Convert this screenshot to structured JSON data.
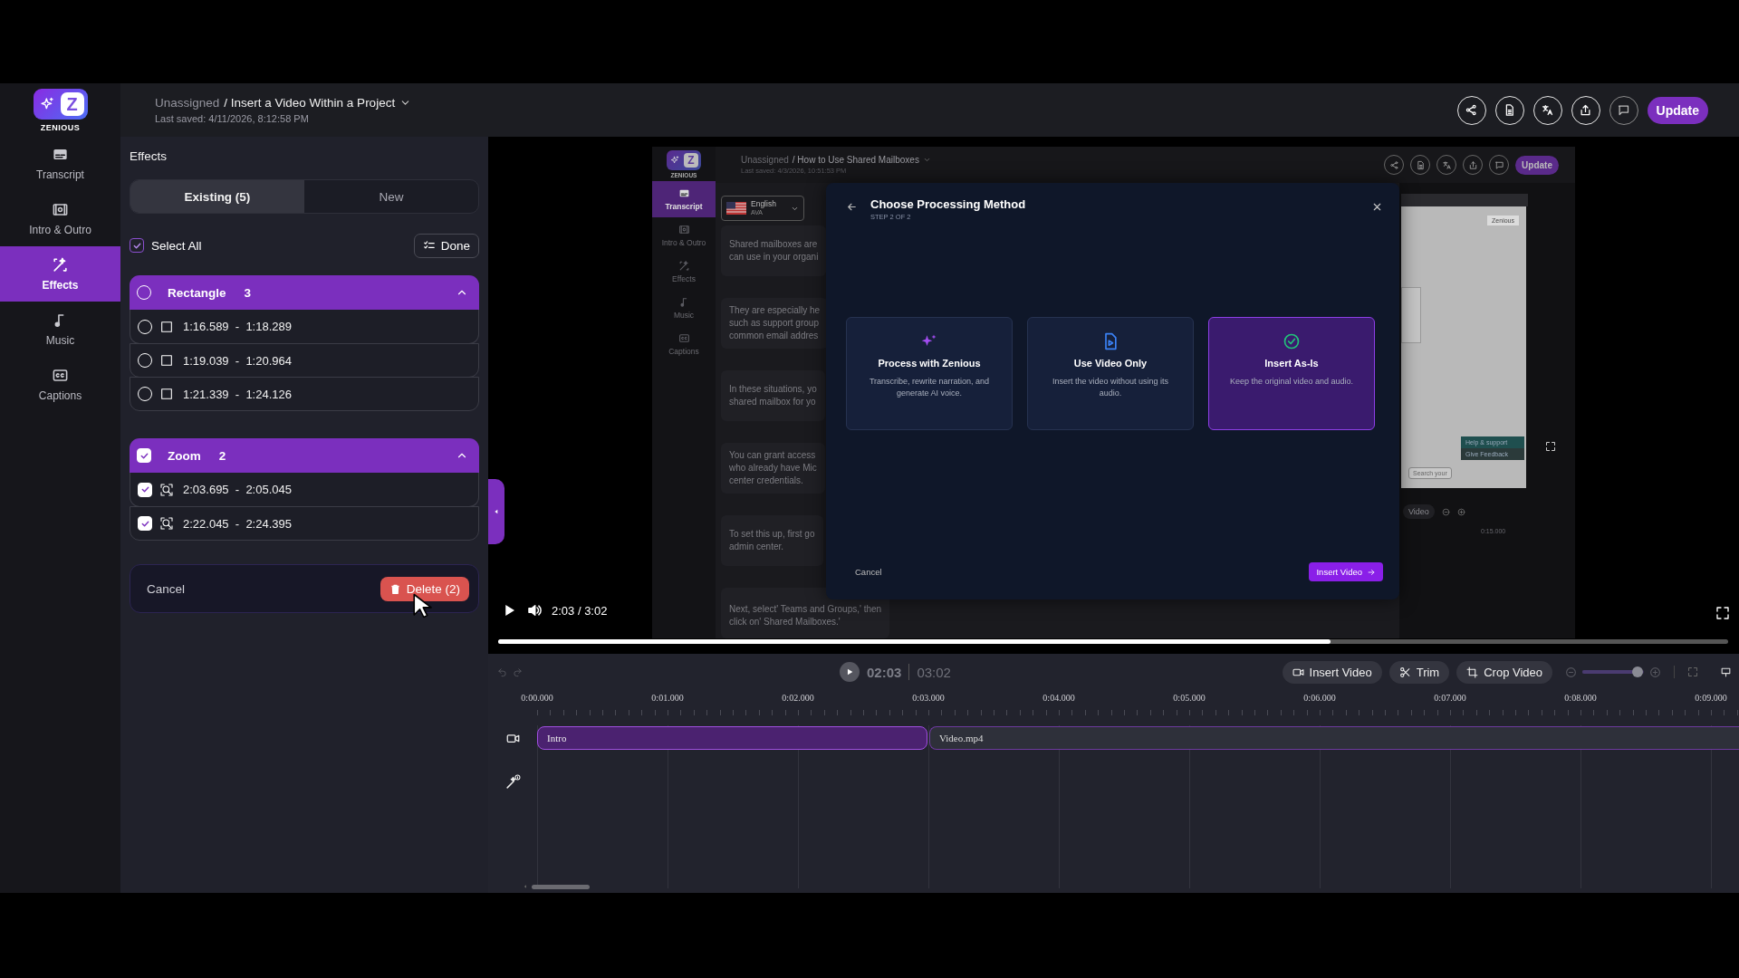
{
  "logo": {
    "mark": "Z",
    "wordmark": "ZENIOUS"
  },
  "nav": [
    {
      "label": "Transcript",
      "selected": false
    },
    {
      "label": "Intro & Outro",
      "selected": false
    },
    {
      "label": "Effects",
      "selected": true
    },
    {
      "label": "Music",
      "selected": false
    },
    {
      "label": "Captions",
      "selected": false
    }
  ],
  "header": {
    "folder": "Unassigned",
    "title": "/ Insert a Video Within a Project",
    "saved": "Last saved: 4/11/2026, 8:12:58 PM",
    "update": "Update"
  },
  "panel": {
    "title": "Effects",
    "tabs": [
      {
        "label": "Existing (5)",
        "selected": true
      },
      {
        "label": "New",
        "selected": false
      }
    ],
    "select_all": {
      "label": "Select All",
      "checked": true
    },
    "done": "Done",
    "groups": [
      {
        "name": "Rectangle",
        "count": "3",
        "kind": "rectangle",
        "checked": false,
        "expanded": true,
        "items": [
          {
            "range": "1:16.589  -  1:18.289",
            "checked": false
          },
          {
            "range": "1:19.039  -  1:20.964",
            "checked": false
          },
          {
            "range": "1:21.339  -  1:24.126",
            "checked": false
          }
        ]
      },
      {
        "name": "Zoom",
        "count": "2",
        "kind": "zoom",
        "checked": true,
        "expanded": true,
        "items": [
          {
            "range": "2:03.695  -  2:05.045",
            "checked": true
          },
          {
            "range": "2:22.045  -  2:24.395",
            "checked": true
          }
        ]
      }
    ],
    "cancel": "Cancel",
    "delete": "Delete (2)"
  },
  "player": {
    "time": "2:03 / 3:02",
    "level": 0.677,
    "frame": {
      "logo": {
        "mark": "Z",
        "wordmark": "ZENIOUS"
      },
      "nav": [
        {
          "label": "Transcript",
          "selected": true
        },
        {
          "label": "Intro & Outro",
          "selected": false
        },
        {
          "label": "Effects",
          "selected": false
        },
        {
          "label": "Music",
          "selected": false
        },
        {
          "label": "Captions",
          "selected": false
        }
      ],
      "header": {
        "folder": "Unassigned",
        "title": "/ How to Use Shared Mailboxes",
        "saved": "Last saved: 4/3/2026, 10:51:53 PM",
        "update": "Update"
      },
      "language": {
        "name": "English",
        "voice": "AVA"
      },
      "transcript": [
        "Shared mailboxes are\ncan use in your organi",
        "They are especially he\nsuch as support group\ncommon email addres",
        "In these situations, yo\nshared mailbox for yo",
        "You can grant access\nwho already have Mic\ncenter credentials.",
        "To set this up, first go\nadmin center.",
        "Next, select' Teams and Groups,' then\nclick on' Shared Mailboxes.'"
      ],
      "dialog": {
        "title": "Choose Processing Method",
        "step": "STEP 2 OF 2",
        "options": [
          {
            "title": "Process with Zenious",
            "description": "Transcribe, rewrite narration, and generate AI voice.",
            "selected": false
          },
          {
            "title": "Use Video Only",
            "description": "Insert the video without using its audio.",
            "selected": false
          },
          {
            "title": "Insert As-Is",
            "description": "Keep the original video and audio.",
            "selected": true
          }
        ],
        "cancel": "Cancel",
        "confirm": "Insert Video"
      },
      "preview": {
        "label": "Zenious",
        "help": "Help & support",
        "feedback": "Give Feedback",
        "search": "Search your"
      },
      "timeline": {
        "tool": "Video",
        "tick": "0:15.000"
      }
    }
  },
  "timeline": {
    "current": "02:03",
    "total": "03:02",
    "tools": [
      {
        "label": "Insert Video"
      },
      {
        "label": "Trim"
      },
      {
        "label": "Crop Video"
      }
    ],
    "zoom": {
      "level": 0.9
    },
    "ruler": [
      "0:00.000",
      "0:01.000",
      "0:02.000",
      "0:03.000",
      "0:04.000",
      "0:05.000",
      "0:06.000",
      "0:07.000",
      "0:08.000",
      "0:09.000"
    ],
    "clips": [
      {
        "label": "Intro",
        "kind": "intro"
      },
      {
        "label": "Video.mp4",
        "kind": "video"
      }
    ]
  }
}
